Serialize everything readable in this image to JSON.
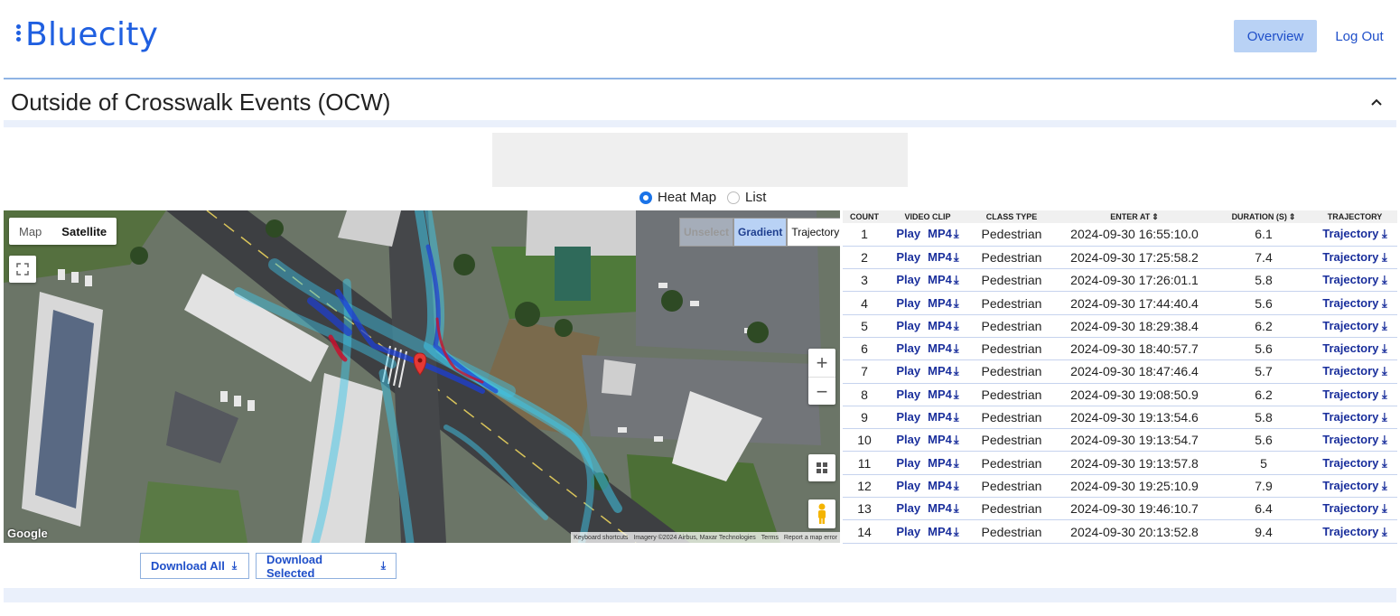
{
  "header": {
    "logo_text": "Bluecity",
    "nav": {
      "overview": "Overview",
      "logout": "Log Out"
    }
  },
  "section": {
    "title": "Outside of Crosswalk Events (OCW)",
    "collapse_icon": "chevron-up-icon"
  },
  "view_toggle": {
    "heat_map_label": "Heat Map",
    "list_label": "List",
    "selected": "Heat Map"
  },
  "map": {
    "type_map": "Map",
    "type_satellite": "Satellite",
    "type_selected": "Satellite",
    "modes": {
      "unselect": "Unselect",
      "gradient": "Gradient",
      "trajectory": "Trajectory"
    },
    "mode_selected": "Gradient",
    "zoom_in": "+",
    "zoom_out": "−",
    "google": "Google",
    "attribution": [
      "Keyboard shortcuts",
      "Imagery ©2024 Airbus, Maxar Technologies",
      "Terms",
      "Report a map error"
    ]
  },
  "table": {
    "columns": [
      "Count",
      "Video Clip",
      "Class Type",
      "Enter At",
      "Duration (s)",
      "Trajectory"
    ],
    "play_label": "Play",
    "mp4_label": "MP4",
    "trajectory_label": "Trajectory",
    "rows": [
      {
        "count": "1",
        "class": "Pedestrian",
        "enter": "2024-09-30 16:55:10.0",
        "duration": "6.1"
      },
      {
        "count": "2",
        "class": "Pedestrian",
        "enter": "2024-09-30 17:25:58.2",
        "duration": "7.4"
      },
      {
        "count": "3",
        "class": "Pedestrian",
        "enter": "2024-09-30 17:26:01.1",
        "duration": "5.8"
      },
      {
        "count": "4",
        "class": "Pedestrian",
        "enter": "2024-09-30 17:44:40.4",
        "duration": "5.6"
      },
      {
        "count": "5",
        "class": "Pedestrian",
        "enter": "2024-09-30 18:29:38.4",
        "duration": "6.2"
      },
      {
        "count": "6",
        "class": "Pedestrian",
        "enter": "2024-09-30 18:40:57.7",
        "duration": "5.6"
      },
      {
        "count": "7",
        "class": "Pedestrian",
        "enter": "2024-09-30 18:47:46.4",
        "duration": "5.7"
      },
      {
        "count": "8",
        "class": "Pedestrian",
        "enter": "2024-09-30 19:08:50.9",
        "duration": "6.2"
      },
      {
        "count": "9",
        "class": "Pedestrian",
        "enter": "2024-09-30 19:13:54.6",
        "duration": "5.8"
      },
      {
        "count": "10",
        "class": "Pedestrian",
        "enter": "2024-09-30 19:13:54.7",
        "duration": "5.6"
      },
      {
        "count": "11",
        "class": "Pedestrian",
        "enter": "2024-09-30 19:13:57.8",
        "duration": "5"
      },
      {
        "count": "12",
        "class": "Pedestrian",
        "enter": "2024-09-30 19:25:10.9",
        "duration": "7.9"
      },
      {
        "count": "13",
        "class": "Pedestrian",
        "enter": "2024-09-30 19:46:10.7",
        "duration": "6.4"
      },
      {
        "count": "14",
        "class": "Pedestrian",
        "enter": "2024-09-30 20:13:52.8",
        "duration": "9.4"
      }
    ]
  },
  "buttons": {
    "download_all": "Download All",
    "download_selected": "Download Selected"
  },
  "colors": {
    "brand": "#1f5fe0",
    "link": "#1a2f9c",
    "nav_active_bg": "#b9d2f5",
    "heat_primary": "#3fc6e8",
    "heat_dense": "#1c3fd4",
    "heat_hot": "#c8102e"
  }
}
